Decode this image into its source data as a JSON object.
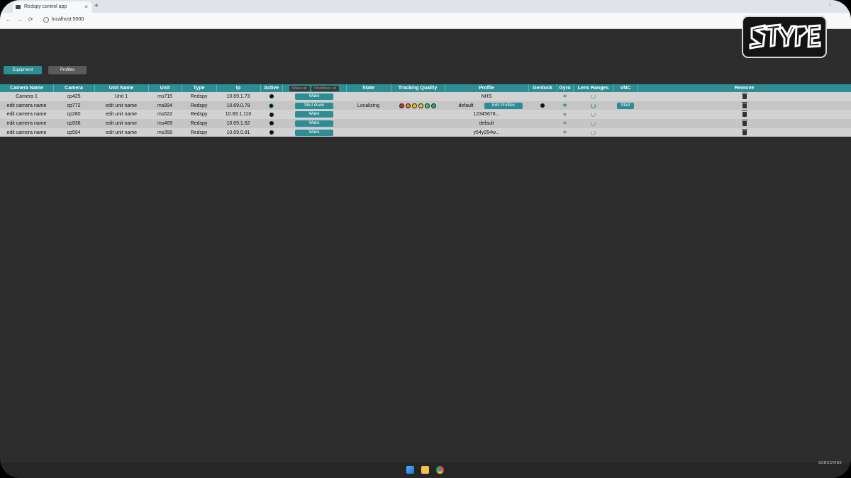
{
  "browser": {
    "tab_title": "Redspy control app",
    "tab_close": "×",
    "new_tab": "+",
    "url": "localhost:5000",
    "window_button": "◦",
    "nav_back": "←",
    "nav_forward": "→",
    "nav_reload": "⟳"
  },
  "logo": {
    "text": "STYPE"
  },
  "top_buttons": {
    "equipment": "Equipment",
    "profiles": "Profiles"
  },
  "table": {
    "headers": {
      "camera_name": "Camera Name",
      "camera": "Camera",
      "unit_name": "Unit Name",
      "unit": "Unit",
      "type": "Type",
      "ip": "Ip",
      "active": "Active",
      "wake_all": "Wake all",
      "shutdown_all": "Shutdown all",
      "state": "State",
      "tracking_quality": "Tracking Quality",
      "profile": "Profile",
      "genlock": "Genlock",
      "gyro": "Gyro",
      "lens_ranges": "Lens Ranges",
      "vnc": "VNC",
      "remove": "Remove"
    },
    "rows": [
      {
        "camera_name": "Camera 1",
        "camera": "cp425",
        "unit_name": "Unit 1",
        "unit": "ms715",
        "type": "Redspy",
        "ip": "10.69.1.73",
        "action": "Wake",
        "state": "",
        "profile": "NHS"
      },
      {
        "camera_name": "edit camera name",
        "camera": "cp772",
        "unit_name": "edit unit name",
        "unit": "ms894",
        "type": "Redspy",
        "ip": "10.69.0.78",
        "action": "Shut down",
        "state": "Localizing",
        "profile": "default",
        "edit_profiles": "Edit Profiles",
        "vnc": "Start"
      },
      {
        "camera_name": "edit camera name",
        "camera": "cp280",
        "unit_name": "edit unit name",
        "unit": "ms522",
        "type": "Redspy",
        "ip": "10.69.1.110",
        "action": "Wake",
        "state": "",
        "profile": "12345678..."
      },
      {
        "camera_name": "edit camera name",
        "camera": "cp936",
        "unit_name": "edit unit name",
        "unit": "ms469",
        "type": "Redspy",
        "ip": "10.69.1.62",
        "action": "Wake",
        "state": "",
        "profile": "default"
      },
      {
        "camera_name": "edit camera name",
        "camera": "cp594",
        "unit_name": "edit unit name",
        "unit": "ms358",
        "type": "Redspy",
        "ip": "10.69.0.81",
        "action": "Wake",
        "state": "",
        "profile": "y54y254w..."
      }
    ],
    "tracking_quality_colors": [
      "#c0392b",
      "#e67e22",
      "#f1c40f",
      "#f1c40f",
      "#2ecc71",
      "#27ae60"
    ]
  },
  "overlay": {
    "subscribe": "SUBSCRIBE"
  },
  "colors": {
    "accent": "#2c8d94",
    "background": "#2d2d2d"
  }
}
